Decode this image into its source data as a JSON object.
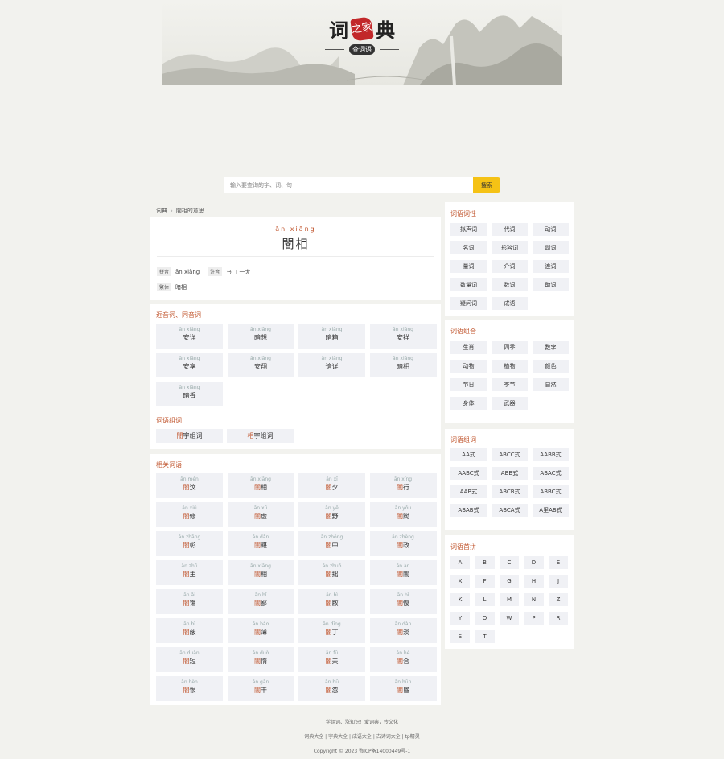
{
  "logo": {
    "left": "词",
    "seal": "之家",
    "right": "典",
    "sub": "查词语"
  },
  "search": {
    "placeholder": "输入要查询的字、词、句",
    "button": "搜索"
  },
  "breadcrumb": {
    "home": "词典",
    "current": "闇相的意思"
  },
  "entry": {
    "pinyin": "ān  xiāng",
    "word": "闇相",
    "fields": [
      {
        "tag": "拼音",
        "value": "ān xiāng"
      },
      {
        "tag": "注音",
        "value": "ㄢ ㄒ一ㄤ"
      },
      {
        "tag": "繁体",
        "value": "暗相"
      }
    ]
  },
  "near": {
    "title": "近音词、同音词",
    "items": [
      {
        "py": "ān xiáng",
        "hz": "安详"
      },
      {
        "py": "ān xiǎng",
        "hz": "暗想"
      },
      {
        "py": "ān xiāng",
        "hz": "暗箱"
      },
      {
        "py": "ān xiáng",
        "hz": "安祥"
      },
      {
        "py": "ān xiǎng",
        "hz": "安享"
      },
      {
        "py": "ān xiāng",
        "hz": "安翔"
      },
      {
        "py": "ān xiāng",
        "hz": "谙详"
      },
      {
        "py": "ān xiāng",
        "hz": "暗相"
      },
      {
        "py": "ān xiāng",
        "hz": "暗香"
      }
    ],
    "group_title": "词语组词",
    "groups": [
      {
        "hl": "闇",
        "rest": "字组词"
      },
      {
        "hl": "相",
        "rest": "字组词"
      }
    ]
  },
  "related": {
    "title": "相关词语",
    "items": [
      {
        "py": "ān mén",
        "hl": "闇",
        "rest": "汶"
      },
      {
        "py": "ān xiāng",
        "hl": "闇",
        "rest": "相"
      },
      {
        "py": "ān xī",
        "hl": "闇",
        "rest": "夕"
      },
      {
        "py": "ān xíng",
        "hl": "闇",
        "rest": "行"
      },
      {
        "py": "ān xiū",
        "hl": "闇",
        "rest": "修"
      },
      {
        "py": "ān xū",
        "hl": "闇",
        "rest": "虚"
      },
      {
        "py": "ān yě",
        "hl": "闇",
        "rest": "野"
      },
      {
        "py": "ān yǒu",
        "hl": "闇",
        "rest": "黝"
      },
      {
        "py": "ān zhāng",
        "hl": "闇",
        "rest": "彰"
      },
      {
        "py": "ān dǎn",
        "hl": "闇",
        "rest": "黮"
      },
      {
        "py": "ān zhōng",
        "hl": "闇",
        "rest": "中"
      },
      {
        "py": "ān zhèng",
        "hl": "闇",
        "rest": "政"
      },
      {
        "py": "ān zhǔ",
        "hl": "闇",
        "rest": "主"
      },
      {
        "py": "ān xiāng",
        "hl": "闇",
        "rest": "相"
      },
      {
        "py": "ān zhuō",
        "hl": "闇",
        "rest": "拙"
      },
      {
        "py": "ān àn",
        "hl": "闇",
        "rest": "闇"
      },
      {
        "py": "ān ǎi",
        "hl": "闇",
        "rest": "霭"
      },
      {
        "py": "ān bǐ",
        "hl": "闇",
        "rest": "鄙"
      },
      {
        "py": "ān bì",
        "hl": "闇",
        "rest": "敝"
      },
      {
        "py": "ān bì",
        "hl": "闇",
        "rest": "愎"
      },
      {
        "py": "ān bì",
        "hl": "闇",
        "rest": "蔽"
      },
      {
        "py": "ān báo",
        "hl": "闇",
        "rest": "薄"
      },
      {
        "py": "ān dīng",
        "hl": "闇",
        "rest": "丁"
      },
      {
        "py": "ān dàn",
        "hl": "闇",
        "rest": "淡"
      },
      {
        "py": "ān duǎn",
        "hl": "闇",
        "rest": "短"
      },
      {
        "py": "ān duò",
        "hl": "闇",
        "rest": "惰"
      },
      {
        "py": "ān fū",
        "hl": "闇",
        "rest": "夫"
      },
      {
        "py": "ān hé",
        "hl": "闇",
        "rest": "合"
      },
      {
        "py": "ān hèn",
        "hl": "闇",
        "rest": "恨"
      },
      {
        "py": "ān gān",
        "hl": "闇",
        "rest": "干"
      },
      {
        "py": "ān hū",
        "hl": "闇",
        "rest": "忽"
      },
      {
        "py": "ān hūn",
        "hl": "闇",
        "rest": "昬"
      }
    ]
  },
  "sidebar": {
    "pos": {
      "title": "词语词性",
      "items": [
        "拟声词",
        "代词",
        "动词",
        "名词",
        "形容词",
        "副词",
        "量词",
        "介词",
        "连词",
        "数量词",
        "数词",
        "助词",
        "疑问词",
        "成语"
      ]
    },
    "combo": {
      "title": "词语组合",
      "items": [
        "生肖",
        "四季",
        "数字",
        "动物",
        "植物",
        "颜色",
        "节日",
        "季节",
        "自然",
        "身体",
        "武器"
      ]
    },
    "form": {
      "title": "词语组词",
      "items": [
        "AA式",
        "ABCC式",
        "AABB式",
        "AABC式",
        "ABB式",
        "ABAC式",
        "AAB式",
        "ABCB式",
        "ABBC式",
        "ABAB式",
        "ABCA式",
        "A里AB式"
      ]
    },
    "initials": {
      "title": "词语首拼",
      "items": [
        "A",
        "B",
        "C",
        "D",
        "E",
        "X",
        "F",
        "G",
        "H",
        "J",
        "K",
        "L",
        "M",
        "N",
        "Z",
        "Y",
        "O",
        "W",
        "P",
        "R",
        "S",
        "T"
      ]
    }
  },
  "footer": {
    "slogan": "学组词、涨知识！爱词典，传文化",
    "links": "词典大全 | 字典大全 | 成语大全 | 古诗词大全 | tp精灵",
    "copyright": "Copyright © 2023 鄂ICP备14000449号-1"
  },
  "colors": {
    "accent": "#c0542c",
    "button": "#f5c215",
    "tile": "#f0f1f5",
    "bg": "#f2f2ee"
  }
}
